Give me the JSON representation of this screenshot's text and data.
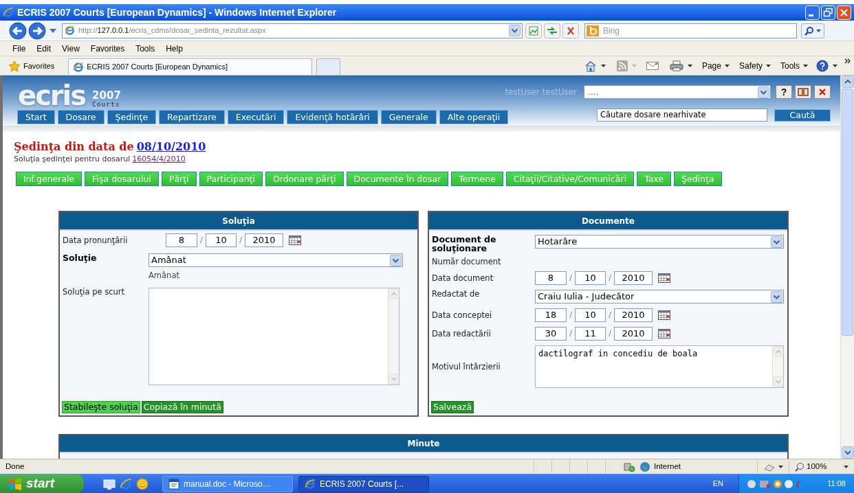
{
  "window": {
    "title": "ECRIS 2007 Courts [European Dynamics] - Windows Internet Explorer"
  },
  "address_bar": {
    "url_parts": [
      {
        "text": "http://",
        "kind": "dim"
      },
      {
        "text": "127.0.0.1",
        "kind": "host"
      },
      {
        "text": "/ecris_cdms/dosar_sedinta_rezultat.aspx",
        "kind": "dim"
      }
    ]
  },
  "search_box": {
    "placeholder": "Bing"
  },
  "menu_bar": [
    "File",
    "Edit",
    "View",
    "Favorites",
    "Tools",
    "Help"
  ],
  "favorites_bar": {
    "label": "Favorites",
    "tabs": [
      {
        "label": "ECRIS 2007 Courts [European Dynamics]",
        "selected": true
      }
    ]
  },
  "command_bar": [
    "Page",
    "Safety",
    "Tools"
  ],
  "app": {
    "logo": {
      "name": "ecris",
      "year": "2007",
      "subtitle": "Courts"
    },
    "user": "testUser testUser",
    "court_select": {
      "value": "...."
    },
    "help_label": "?",
    "nav": [
      "Start",
      "Dosare",
      "Şedinţe",
      "Repartizare",
      "Executări",
      "Evidenţă hotărâri",
      "Generale",
      "Alte operaţii"
    ],
    "search": {
      "value": "Căutare dosare nearhivate",
      "button": "Caută"
    },
    "heading": {
      "text": "Şedinţa din data de ",
      "link": "08/10/2010"
    },
    "subheading": {
      "text": "Soluţia şedinţei pentru dosarul ",
      "link": "16054/4/2010"
    },
    "tabs": [
      "Inf.generale",
      "Fişa dosarului",
      "Părţi",
      "Participanţi",
      "Ordonare părţi",
      "Documente în dosar",
      "Termene",
      "Citaţii/Citative/Comunicări",
      "Taxe",
      "Şedinţa"
    ],
    "solution_panel": {
      "title": "Soluţia",
      "rows": [
        {
          "kind": "date",
          "label": "Data pronunţării",
          "required": false,
          "day": "8",
          "month": "10",
          "year": "2010",
          "separators": [
            "/",
            "/"
          ]
        },
        {
          "kind": "select",
          "label": "Soluţie",
          "required": true,
          "value": "Amânat",
          "hint": "Amânat"
        },
        {
          "kind": "textarea",
          "label": "Soluţia pe scurt",
          "required": false
        }
      ],
      "buttons": [
        {
          "label": "Stabileşte soluţia",
          "kind": "light"
        },
        {
          "label": "Copiază în minută",
          "kind": "dark"
        }
      ]
    },
    "documents_panel": {
      "title": "Documente",
      "rows": [
        {
          "kind": "select",
          "label": "Document de soluţionare",
          "required": true,
          "value": "Hotarâre"
        },
        {
          "kind": "label",
          "label": "Număr document",
          "required": false
        },
        {
          "kind": "date",
          "label": "Data document",
          "required": false,
          "day": "8",
          "month": "10",
          "year": "2010",
          "separators": [
            "/",
            "/"
          ]
        },
        {
          "kind": "select",
          "label": "Redactat de",
          "required": false,
          "value": "Craiu Iulia - Judecător"
        },
        {
          "kind": "date",
          "label": "Data conceptei",
          "required": false,
          "day": "18",
          "month": "10",
          "year": "2010",
          "separators": [
            "/",
            "/"
          ]
        },
        {
          "kind": "date",
          "label": "Data redactării",
          "required": false,
          "day": "30",
          "month": "11",
          "year": "2010",
          "separators": [
            "/",
            "/"
          ]
        },
        {
          "kind": "textarea",
          "label": "Motivul întârzierii",
          "required": false,
          "value": "dactilograf in concediu de boala"
        }
      ],
      "buttons": [
        {
          "label": "Salvează",
          "kind": "dark"
        }
      ]
    },
    "minutes_panel": {
      "title": "Minute"
    }
  },
  "status_bar": {
    "text": "Done",
    "zone": "Internet",
    "zoom": "100%"
  },
  "taskbar": {
    "start": "start",
    "windows": [
      {
        "label": "manual.doc - Microso…",
        "kind": "document",
        "selected": false
      },
      {
        "label": "ECRIS 2007 Courts [...",
        "kind": "browser",
        "selected": true
      }
    ],
    "language": "EN",
    "clock": "11:08"
  }
}
